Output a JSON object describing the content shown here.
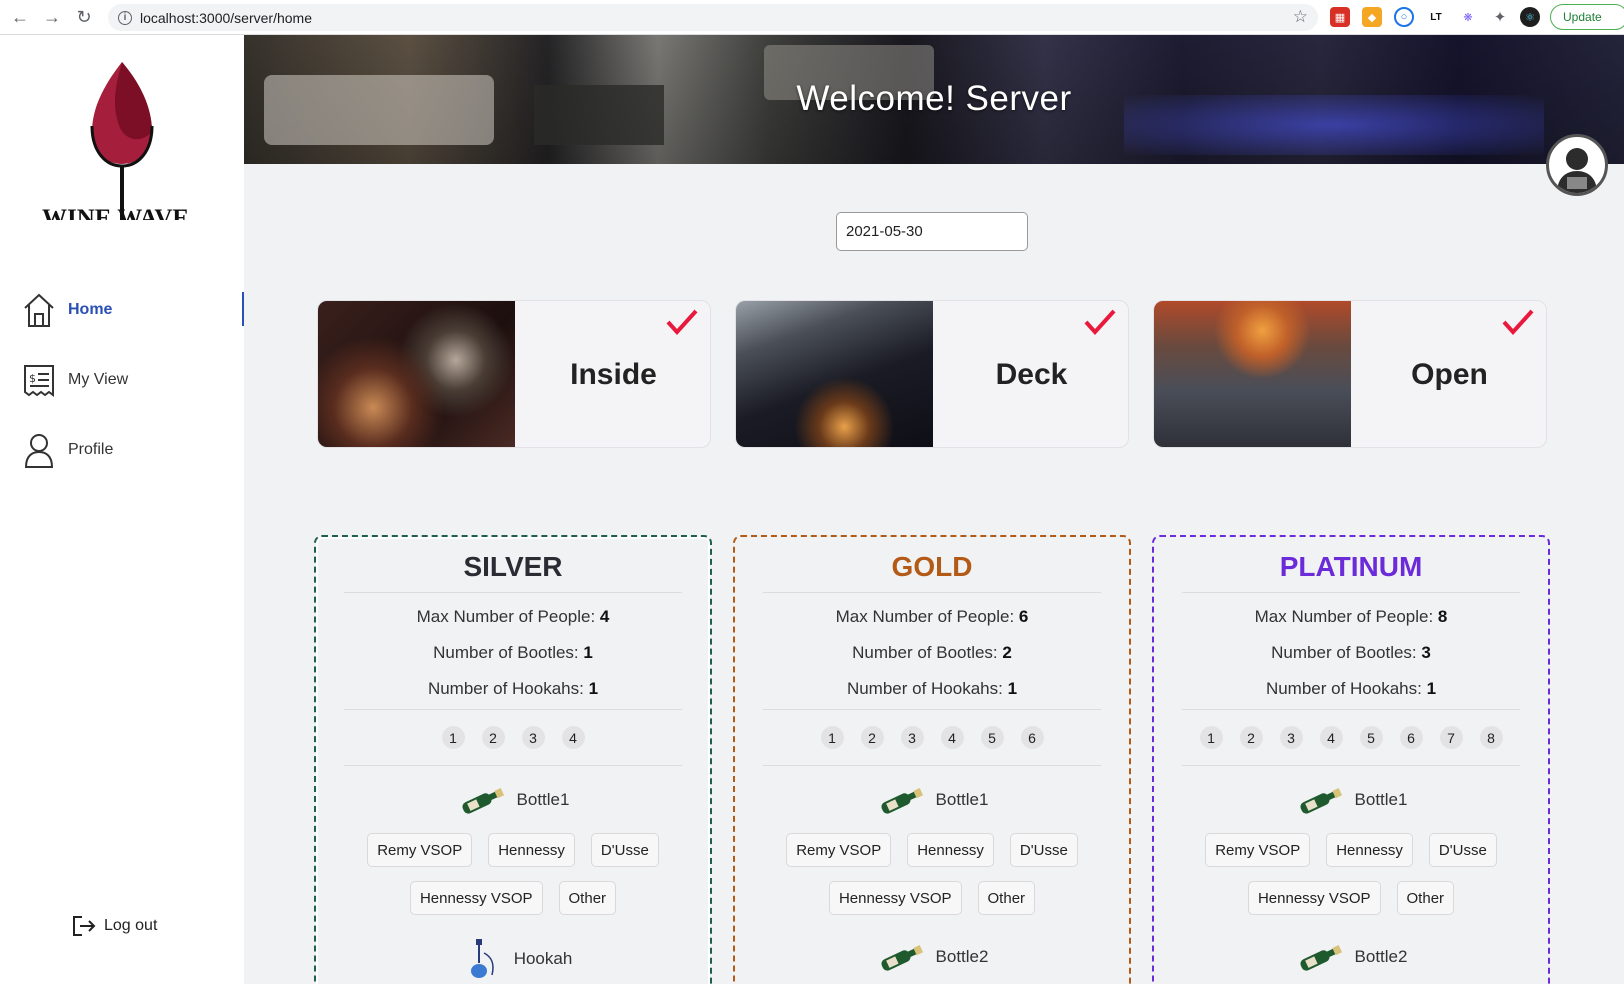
{
  "browser": {
    "url": "localhost:3000/server/home",
    "update_label": "Update"
  },
  "sidebar": {
    "brand": "WINE WAVE",
    "items": [
      {
        "label": "Home",
        "icon": "home-icon"
      },
      {
        "label": "My View",
        "icon": "receipt-icon"
      },
      {
        "label": "Profile",
        "icon": "user-icon"
      }
    ],
    "logout_label": "Log out"
  },
  "banner": {
    "title": "Welcome! Server"
  },
  "date": {
    "value": "2021-05-30"
  },
  "areas": [
    {
      "name": "Inside",
      "checked": true
    },
    {
      "name": "Deck",
      "checked": true
    },
    {
      "name": "Open",
      "checked": true
    }
  ],
  "packages": [
    {
      "name": "SILVER",
      "color": "#2b2b33",
      "max_people_label": "Max Number of People: ",
      "max_people": "4",
      "bottles_label": "Number of Bootles: ",
      "bottles": "1",
      "hookahs_label": "Number of Hookahs: ",
      "hookahs": "1",
      "seats": [
        "1",
        "2",
        "3",
        "4"
      ],
      "first_item": "Bottle1",
      "options_row1": [
        "Remy VSOP",
        "Hennessy",
        "D'Usse"
      ],
      "options_row2": [
        "Hennessy VSOP",
        "Other"
      ],
      "second_item": "Hookah"
    },
    {
      "name": "GOLD",
      "color": "#b35a16",
      "max_people_label": "Max Number of People: ",
      "max_people": "6",
      "bottles_label": "Number of Bootles: ",
      "bottles": "2",
      "hookahs_label": "Number of Hookahs: ",
      "hookahs": "1",
      "seats": [
        "1",
        "2",
        "3",
        "4",
        "5",
        "6"
      ],
      "first_item": "Bottle1",
      "options_row1": [
        "Remy VSOP",
        "Hennessy",
        "D'Usse"
      ],
      "options_row2": [
        "Hennessy VSOP",
        "Other"
      ],
      "second_item": "Bottle2"
    },
    {
      "name": "PLATINUM",
      "color": "#6c2bd9",
      "max_people_label": "Max Number of People: ",
      "max_people": "8",
      "bottles_label": "Number of Bootles: ",
      "bottles": "3",
      "hookahs_label": "Number of Hookahs: ",
      "hookahs": "1",
      "seats": [
        "1",
        "2",
        "3",
        "4",
        "5",
        "6",
        "7",
        "8"
      ],
      "first_item": "Bottle1",
      "options_row1": [
        "Remy VSOP",
        "Hennessy",
        "D'Usse"
      ],
      "options_row2": [
        "Hennessy VSOP",
        "Other"
      ],
      "second_item": "Bottle2"
    }
  ]
}
